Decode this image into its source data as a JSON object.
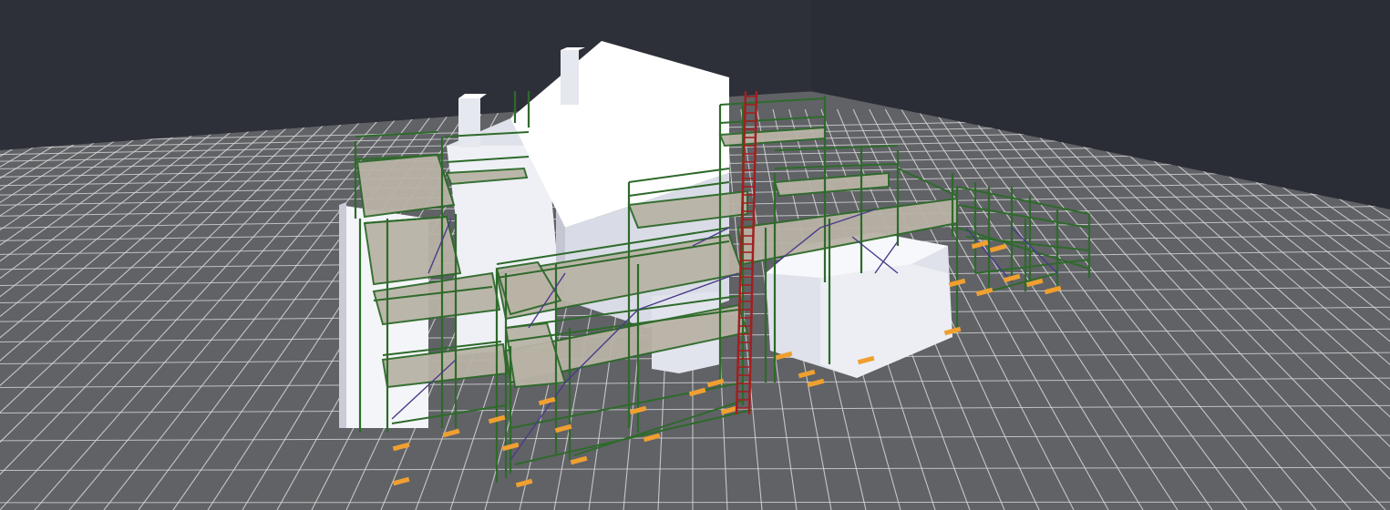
{
  "viewport": {
    "mode": "3d-view",
    "background_color": "#2b2e35"
  },
  "scene": {
    "floor_color": "#606266",
    "grid_line_color": "#d8d8d8",
    "back_wall_color": "#2d3038",
    "house_color": "#f4f5f9",
    "house_shade_color": "#c9ccd6",
    "scaffold_tube_color": "#2e6a2a",
    "scaffold_brace_color": "#4a3a8a",
    "deck_color": "#b9b3a6",
    "base_plate_color": "#f0a030",
    "ladder_color": "#a02020",
    "objects": [
      {
        "name": "house-main",
        "icon": "house-icon"
      },
      {
        "name": "scaffold-system",
        "icon": "scaffold-icon"
      },
      {
        "name": "ladder",
        "icon": "ladder-icon"
      }
    ]
  }
}
